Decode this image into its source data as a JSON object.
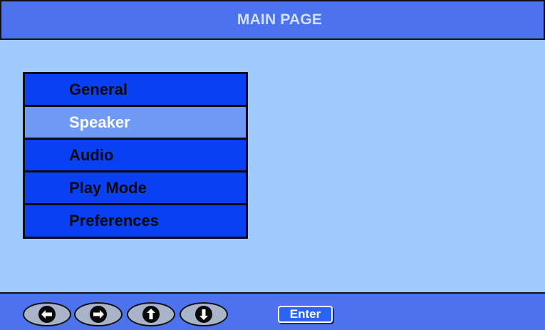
{
  "header": {
    "title": "MAIN PAGE"
  },
  "menu": {
    "items": [
      {
        "label": "General",
        "selected": false
      },
      {
        "label": "Speaker",
        "selected": true
      },
      {
        "label": "Audio",
        "selected": false
      },
      {
        "label": "Play Mode",
        "selected": false
      },
      {
        "label": "Preferences",
        "selected": false
      }
    ]
  },
  "footer": {
    "nav_buttons": [
      {
        "icon": "arrow-left-icon"
      },
      {
        "icon": "arrow-right-icon"
      },
      {
        "icon": "arrow-up-icon"
      },
      {
        "icon": "arrow-down-icon"
      }
    ],
    "enter_label": "Enter"
  },
  "colors": {
    "background": "#a0cbfe",
    "bar": "#4c72ee",
    "menu_item": "#0a40f4",
    "menu_item_selected": "#6f9af6",
    "enter_button": "#2b63f2"
  }
}
